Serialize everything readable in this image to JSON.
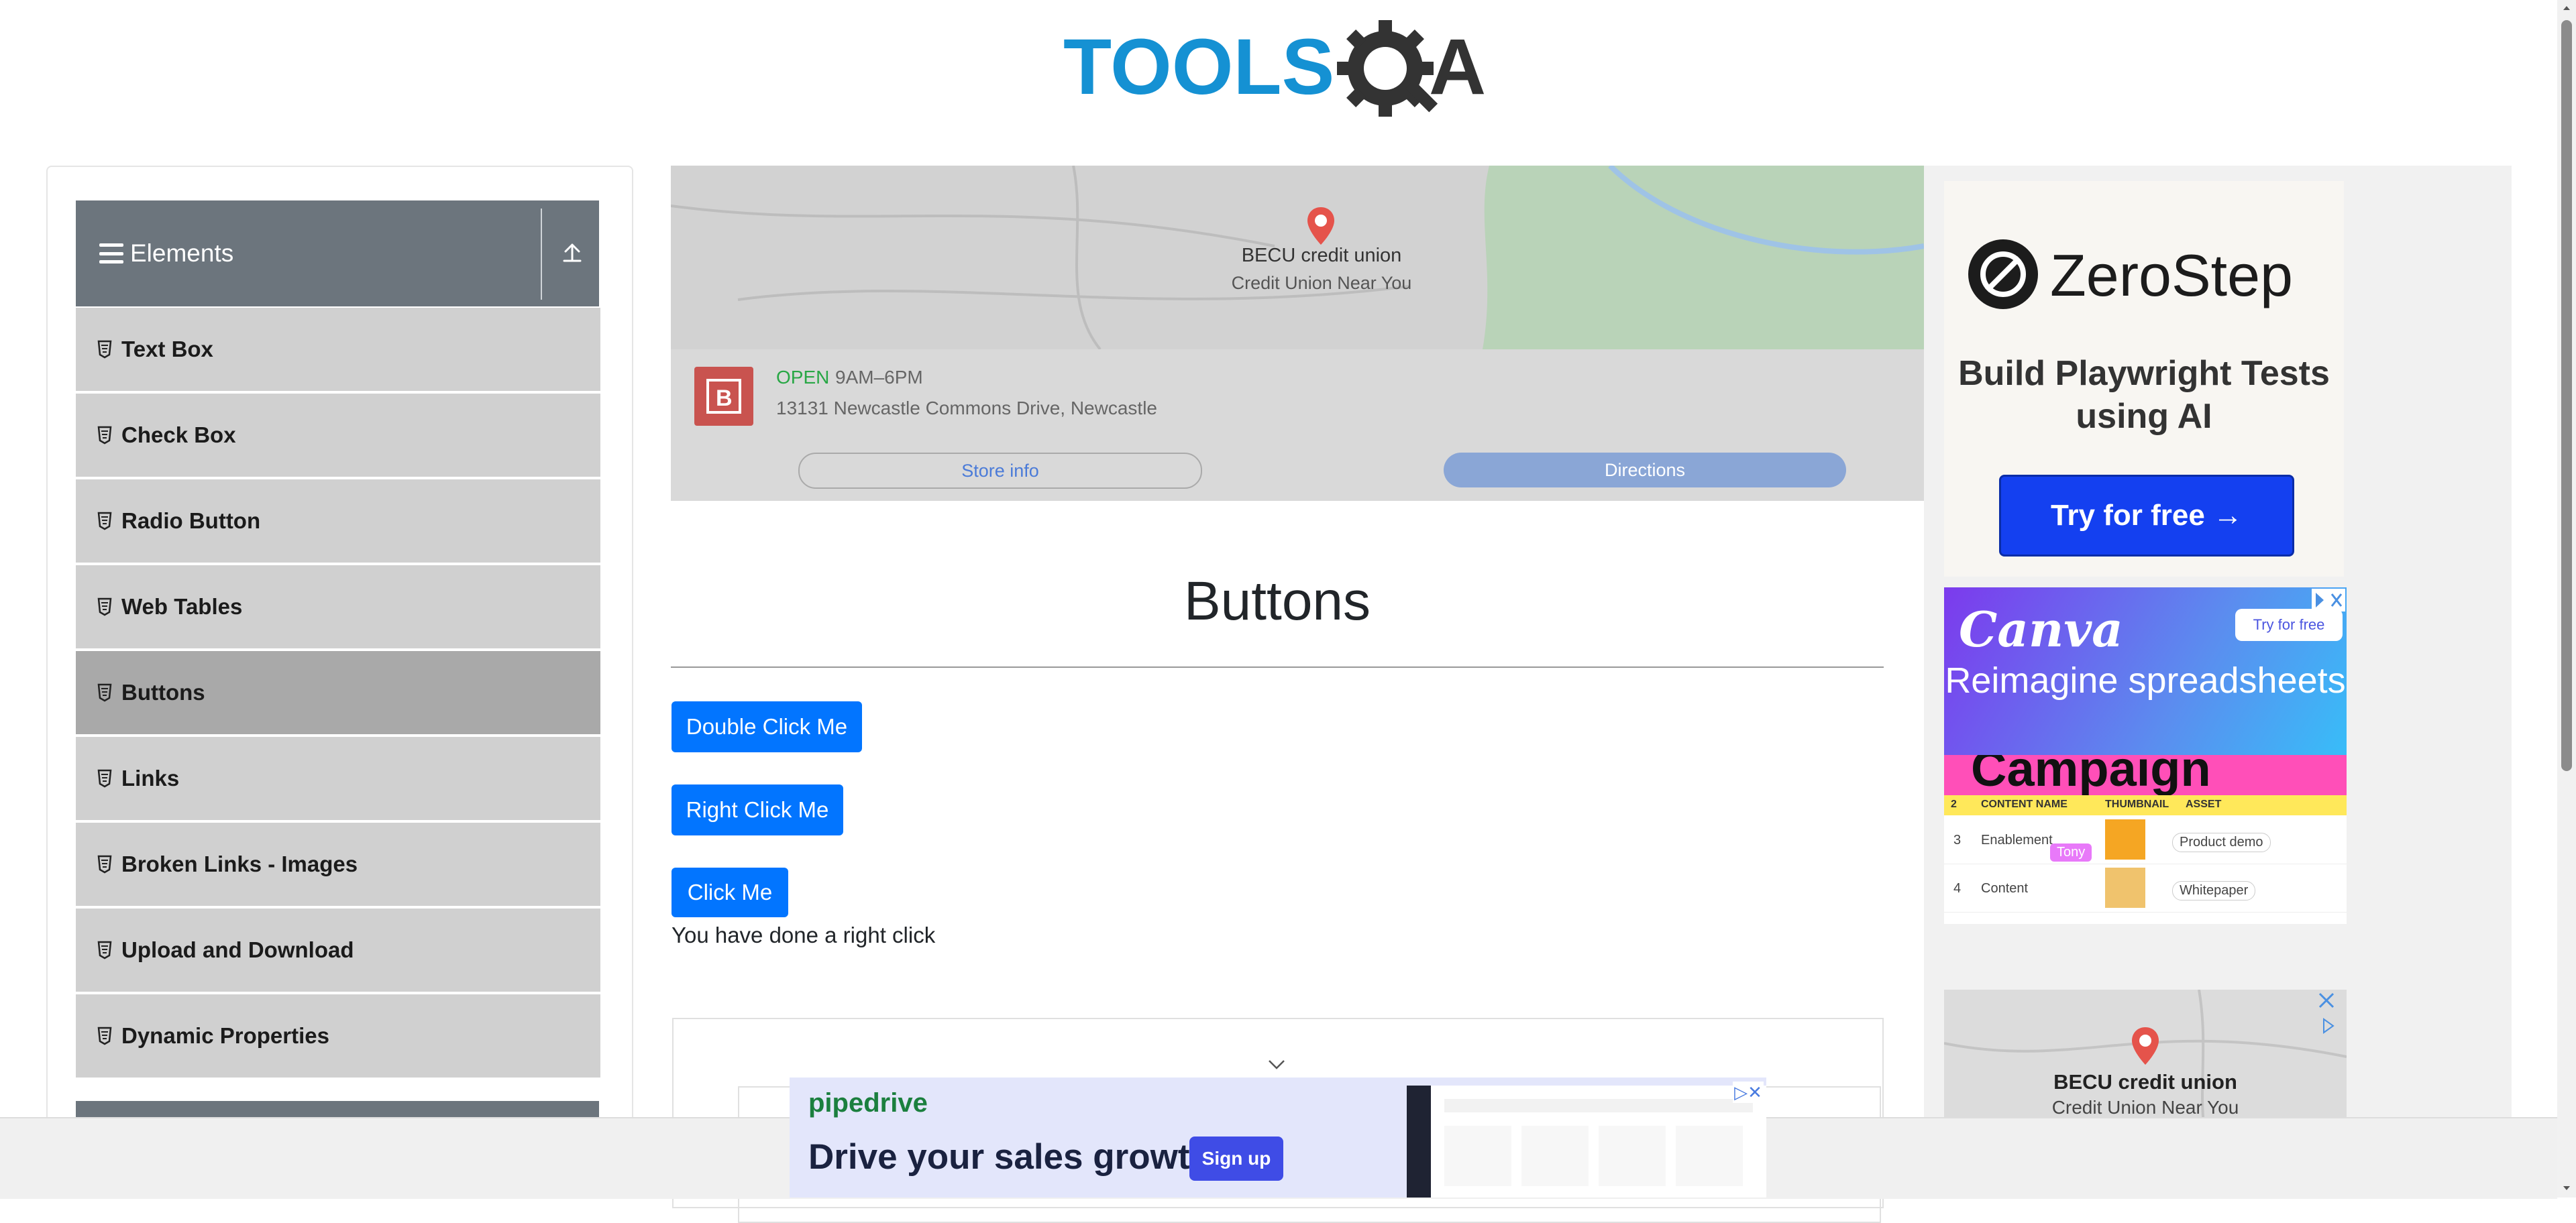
{
  "logo": {
    "text_left": "TOOLS",
    "text_right": "A"
  },
  "sidebar": {
    "group_title": "Elements",
    "items": [
      {
        "label": "Text Box"
      },
      {
        "label": "Check Box"
      },
      {
        "label": "Radio Button"
      },
      {
        "label": "Web Tables"
      },
      {
        "label": "Buttons",
        "active": true
      },
      {
        "label": "Links"
      },
      {
        "label": "Broken Links - Images"
      },
      {
        "label": "Upload and Download"
      },
      {
        "label": "Dynamic Properties"
      }
    ]
  },
  "map_ad": {
    "place_name": "BECU credit union",
    "place_sub": "Credit Union Near You",
    "status": "OPEN",
    "hours": "9AM–6PM",
    "address": "13131 Newcastle Commons Drive, Newcastle",
    "store_info_label": "Store info",
    "directions_label": "Directions"
  },
  "main": {
    "title": "Buttons",
    "double_click_label": "Double Click Me",
    "right_click_label": "Right Click Me",
    "click_label": "Click Me",
    "message": "You have done a right click"
  },
  "ads": {
    "zerostep": {
      "name": "ZeroStep",
      "tagline": "Build Playwright Tests using AI",
      "cta": "Try for free →"
    },
    "canva": {
      "logo": "Canva",
      "try": "Try for free",
      "headline": "Reimagine spreadsheets",
      "banner": "Campaign tracke",
      "columns": [
        "CONTENT NAME",
        "THUMBNAIL",
        "ASSET"
      ],
      "rows": [
        {
          "num": "3",
          "name": "Enablement",
          "tag": "Tony",
          "asset": "Product demo"
        },
        {
          "num": "4",
          "name": "Content",
          "asset": "Whitepaper"
        }
      ]
    },
    "map_small": {
      "place_name": "BECU credit union",
      "place_sub": "Credit Union Near You"
    },
    "pipedrive": {
      "logo": "pipedrive",
      "headline": "Drive your sales growth",
      "cta": "Sign up"
    }
  },
  "colors": {
    "primary_button": "#0275ff",
    "sidebar_header": "#6c757d",
    "menu_item": "#d0d0d0",
    "menu_active": "#a9a9a9"
  }
}
